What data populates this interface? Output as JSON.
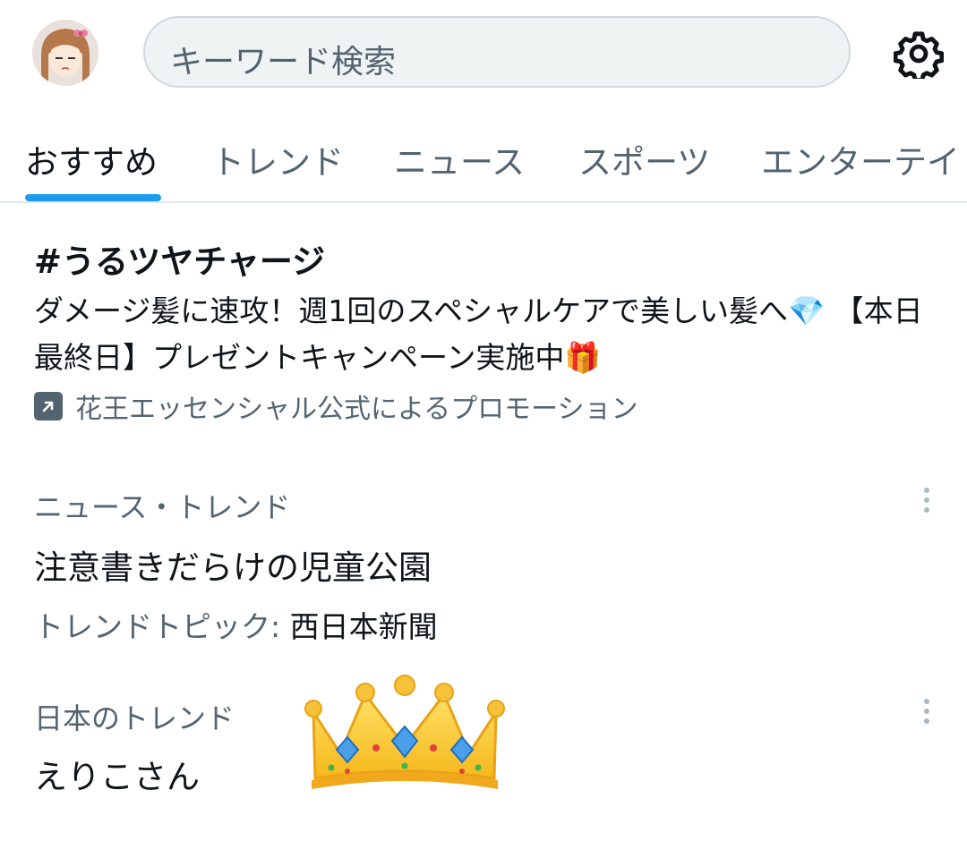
{
  "header": {
    "search_placeholder": "キーワード検索",
    "avatar_icon": "user-avatar",
    "settings_icon": "gear-icon"
  },
  "tabs": [
    {
      "label": "おすすめ",
      "active": true
    },
    {
      "label": "トレンド",
      "active": false
    },
    {
      "label": "ニュース",
      "active": false
    },
    {
      "label": "スポーツ",
      "active": false
    },
    {
      "label": "エンターテイ",
      "active": false
    }
  ],
  "promo": {
    "title": "#うるツヤチャージ",
    "description": "ダメージ髪に速攻！週1回のスペシャルケアで美しい髪へ💎 【本日最終日】プレゼントキャンペーン実施中🎁",
    "promoted_by": "花王エッセンシャル公式によるプロモーション",
    "promo_icon": "promoted-arrow-icon"
  },
  "trends": [
    {
      "category": "ニュース・トレンド",
      "title": "注意書きだらけの児童公園",
      "meta_label": "トレンドトピック:",
      "meta_value": " 西日本新聞"
    },
    {
      "category": "日本のトレンド",
      "title": "えりこさん",
      "emoji_icon": "crown-icon"
    }
  ],
  "colors": {
    "accent": "#1d9bf0",
    "secondary_text": "#536471",
    "primary_text": "#0f1419",
    "search_bg": "#eff3f4"
  }
}
